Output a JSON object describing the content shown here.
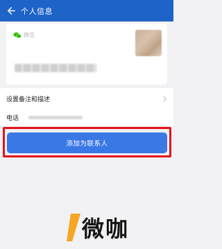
{
  "header": {
    "title": "个人信息",
    "back_icon": "back-arrow-icon"
  },
  "profile_card": {
    "source_label": "微信",
    "source_icon": "wechat-icon"
  },
  "details": {
    "remark_label": "设置备注和描述",
    "phone_label": "电话"
  },
  "actions": {
    "add_contact_label": "添加为联系人"
  },
  "watermark": {
    "text": "微咖"
  },
  "colors": {
    "header_bg": "#1e63c8",
    "button_bg": "#3a78e6",
    "highlight_border": "#e2141a",
    "wechat_green": "#2dc100",
    "watermark_accent": "#f5a623"
  }
}
